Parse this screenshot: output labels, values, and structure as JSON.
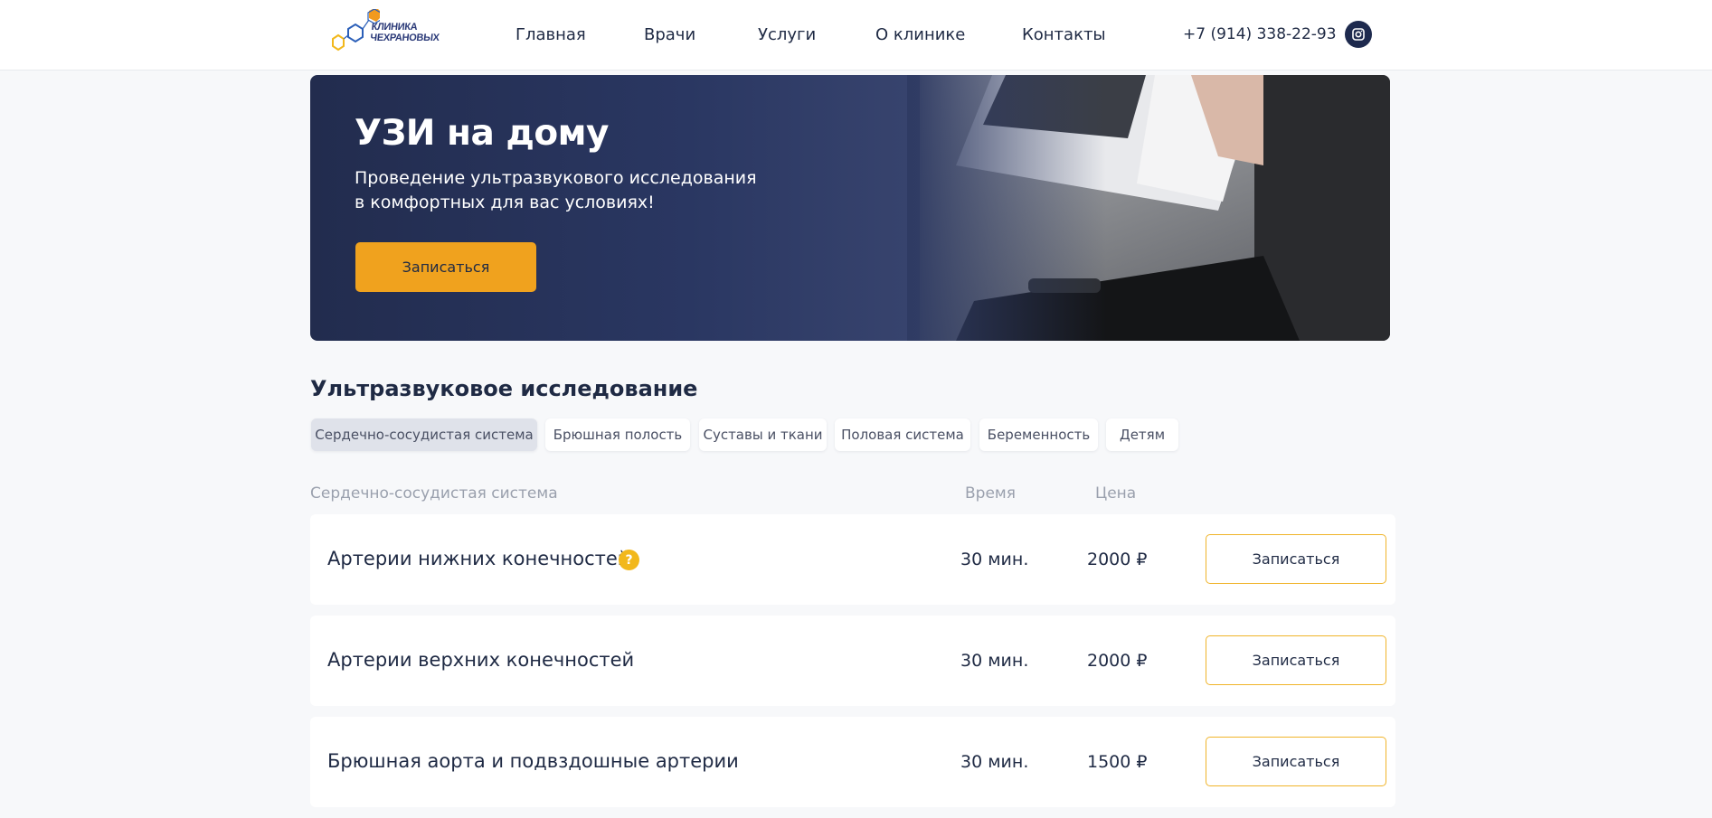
{
  "header": {
    "logo_line1": "КЛИНИКА",
    "logo_line2": "ЧЕХРАНОВЫХ",
    "nav": [
      "Главная",
      "Врачи",
      "Услуги",
      "О клинике",
      "Контакты"
    ],
    "phone": "+7 (914) 338-22-93",
    "social_icon": "instagram-icon"
  },
  "hero": {
    "title": "УЗИ на дому",
    "subtitle_line1": "Проведение ультразвукового исследования",
    "subtitle_line2": "в комфортных для вас условиях!",
    "button": "Записаться"
  },
  "section": {
    "title": "Ультразвуковое исследование",
    "tabs": [
      "Сердечно-сосудистая система",
      "Брюшная полость",
      "Суставы и ткани",
      "Половая система",
      "Беременность",
      "Детям"
    ],
    "active_tab": "Сердечно-сосудистая система"
  },
  "table": {
    "headers": {
      "name": "Сердечно-сосудистая система",
      "time": "Время",
      "price": "Цена"
    },
    "rows": [
      {
        "name": "Артерии нижних конечностей",
        "time": "30 мин.",
        "price": "2000 ₽",
        "button": "Записаться",
        "help": "?"
      },
      {
        "name": "Артерии верхних конечностей",
        "time": "30 мин.",
        "price": "2000 ₽",
        "button": "Записаться"
      },
      {
        "name": "Брюшная аорта и подвздошные артерии",
        "time": "30 мин.",
        "price": "1500 ₽",
        "button": "Записаться"
      }
    ]
  },
  "colors": {
    "accent": "#f0a21e",
    "primary": "#1f2a44",
    "hero_bg": "#222c4e"
  }
}
